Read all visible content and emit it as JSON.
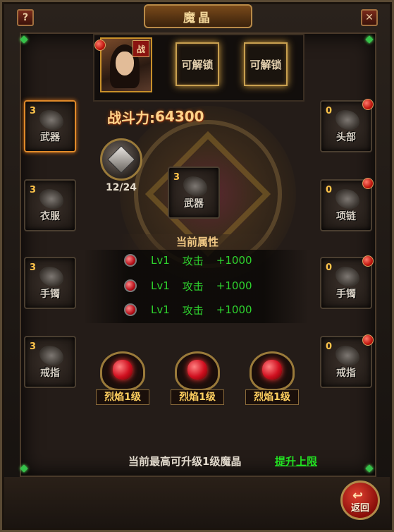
{
  "window": {
    "title": "魔晶",
    "help_label": "?",
    "close_label": "✕"
  },
  "character": {
    "class_badge": "战",
    "locked_slots": [
      "可解锁",
      "可解锁"
    ]
  },
  "power": {
    "label": "战斗力:",
    "value": "64300"
  },
  "crystal": {
    "count": "12/24"
  },
  "left_slots": [
    {
      "count": "3",
      "label": "武器",
      "icon": "sword-icon"
    },
    {
      "count": "3",
      "label": "衣服",
      "icon": "armor-icon"
    },
    {
      "count": "3",
      "label": "手镯",
      "icon": "bracelet-icon"
    },
    {
      "count": "3",
      "label": "戒指",
      "icon": "ring-icon"
    }
  ],
  "right_slots": [
    {
      "count": "0",
      "label": "头部",
      "icon": "helmet-icon"
    },
    {
      "count": "0",
      "label": "项链",
      "icon": "necklace-icon"
    },
    {
      "count": "0",
      "label": "手镯",
      "icon": "bracelet-icon"
    },
    {
      "count": "0",
      "label": "戒指",
      "icon": "ring-icon"
    }
  ],
  "center_slot": {
    "count": "3",
    "label": "武器",
    "icon": "sword-icon"
  },
  "attributes": {
    "header": "当前属性",
    "rows": [
      {
        "level": "Lv1",
        "stat": "攻击",
        "bonus": "+1000"
      },
      {
        "level": "Lv1",
        "stat": "攻击",
        "bonus": "+1000"
      },
      {
        "level": "Lv1",
        "stat": "攻击",
        "bonus": "+1000"
      }
    ]
  },
  "fire_gems": [
    {
      "label": "烈焰1级"
    },
    {
      "label": "烈焰1级"
    },
    {
      "label": "烈焰1级"
    }
  ],
  "footer": {
    "info": "当前最高可升级1级魔晶",
    "link": "提升上限"
  },
  "back_button": {
    "label": "返回"
  },
  "colors": {
    "accent_gold": "#c8a050",
    "attr_green": "#2ed32e",
    "link_green": "#22e022",
    "count_yellow": "#ffc44a"
  }
}
